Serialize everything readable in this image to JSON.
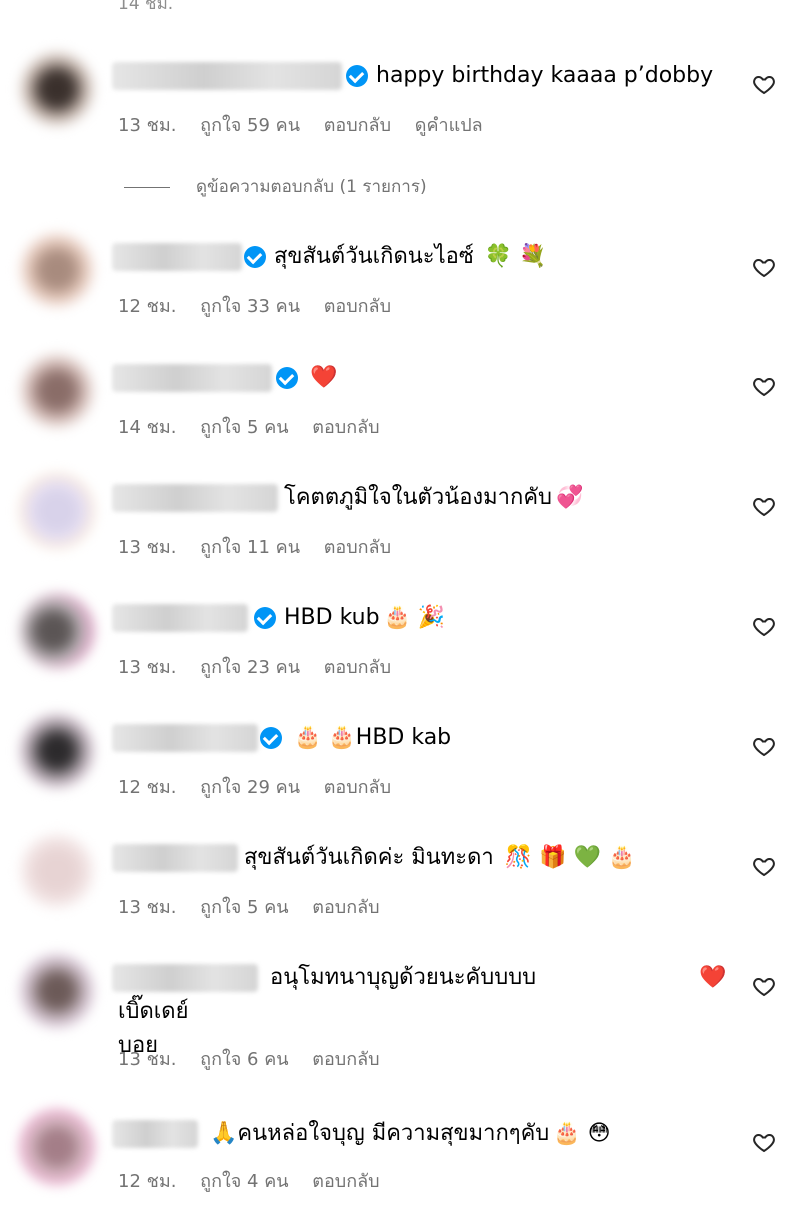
{
  "top_cut_text": "14 ชม.",
  "reply_label": "ตอบกลับ",
  "translate_label": "ดูคำแปล",
  "view_replies": "ดูข้อความตอบกลับ (1 รายการ)",
  "comments": [
    {
      "text": "happy birthday kaaaa p’dobby",
      "time": "13 ชม.",
      "likes": "ถูกใจ 59 คน",
      "verified": true,
      "translate": true
    },
    {
      "text": "สุขสันต์วันเกิดนะไอซ์",
      "emojis": "🍀 💐",
      "time": "12 ชม.",
      "likes": "ถูกใจ 33 คน",
      "verified": true
    },
    {
      "text": "",
      "emojis": "❤️",
      "time": "14 ชม.",
      "likes": "ถูกใจ 5 คน",
      "verified": true
    },
    {
      "text": "โคตตภูมิใจในตัวน้องมากคับ",
      "emojis": "💞",
      "time": "13 ชม.",
      "likes": "ถูกใจ 11 คน",
      "verified": false
    },
    {
      "text": "HBD kub",
      "emojis": "🎂 🎉",
      "time": "13 ชม.",
      "likes": "ถูกใจ 23 คน",
      "verified": true
    },
    {
      "text": "HBD kab",
      "emojis_before": "🎂 🎂",
      "time": "12 ชม.",
      "likes": "ถูกใจ 29 คน",
      "verified": true
    },
    {
      "text": "สุขสันต์วันเกิดค่ะ มินทะดา",
      "emojis": "🎊 🎁 💚 🎂",
      "time": "13 ชม.",
      "likes": "ถูกใจ 5 คน",
      "verified": false
    },
    {
      "text": "อนุโมทนาบุญด้วยนะคับบบบ",
      "emojis": "❤️",
      "text2": "เบิ๊ดเดย์",
      "text3": "บอย",
      "time": "13 ชม.",
      "likes": "ถูกใจ 6 คน",
      "verified": false
    },
    {
      "text": "คนหล่อใจบุญ มีความสุขมากๆคับ",
      "emojis_before": "🙏",
      "emojis": "🎂 😳",
      "time": "12 ชม.",
      "likes": "ถูกใจ 4 คน",
      "verified": false
    }
  ]
}
